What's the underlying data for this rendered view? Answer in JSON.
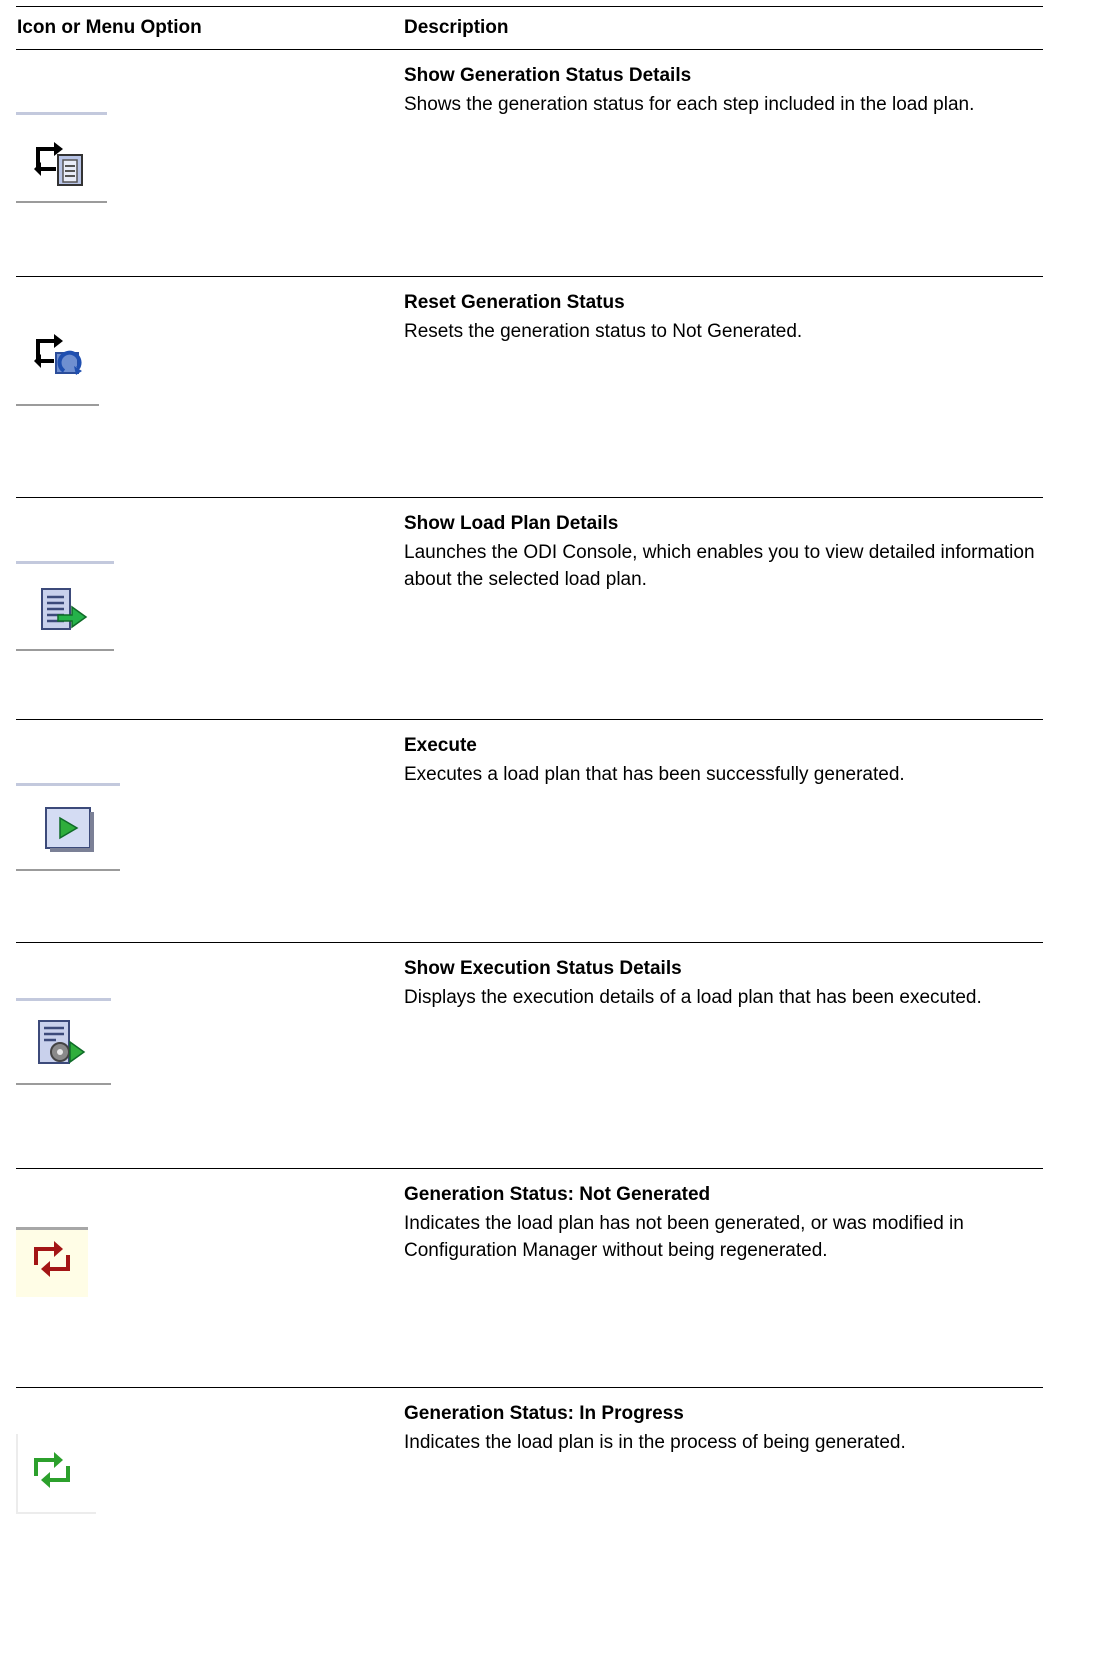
{
  "table": {
    "headers": {
      "icon": "Icon or Menu Option",
      "description": "Description"
    },
    "rows": [
      {
        "icon": "show-generation-status-details-icon",
        "title": "Show Generation Status Details",
        "text": "Shows the generation status for each step included in the load plan."
      },
      {
        "icon": "reset-generation-status-icon",
        "title": "Reset Generation Status",
        "text": "Resets the generation status to Not Generated."
      },
      {
        "icon": "show-load-plan-details-icon",
        "title": "Show Load Plan Details",
        "text": "Launches the ODI Console, which enables you to view detailed information about the selected load plan."
      },
      {
        "icon": "execute-icon",
        "title": "Execute",
        "text": "Executes a load plan that has been successfully generated."
      },
      {
        "icon": "show-execution-status-details-icon",
        "title": "Show Execution Status Details",
        "text": "Displays the execution details of a load plan that has been executed."
      },
      {
        "icon": "generation-status-not-generated-icon",
        "title": "Generation Status: Not Generated",
        "text": "Indicates the load plan has not been generated, or was modified in Configuration Manager without being regenerated."
      },
      {
        "icon": "generation-status-in-progress-icon",
        "title": "Generation Status: In Progress",
        "text": "Indicates the load plan is in the process of being generated."
      }
    ]
  },
  "colors": {
    "not_generated": "#a31515",
    "in_progress": "#2ca02c"
  }
}
